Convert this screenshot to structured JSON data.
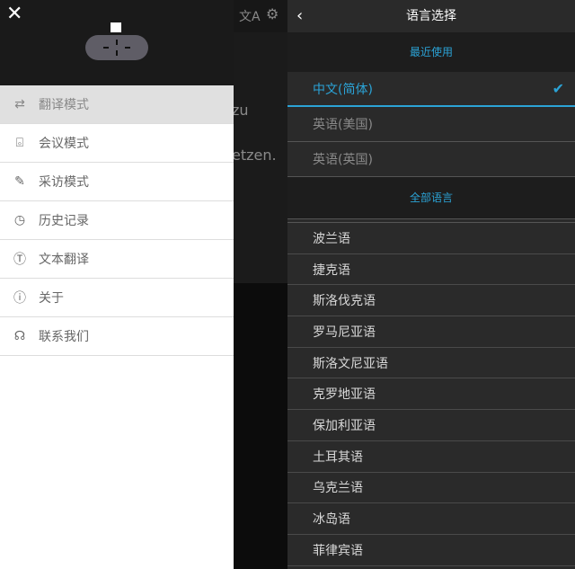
{
  "background": {
    "text_line1": "zu",
    "text_line2": "etzen.",
    "icons": [
      "translate-icon",
      "settings-icon"
    ]
  },
  "drawer": {
    "items": [
      {
        "label": "翻译模式",
        "icon": "swap-icon",
        "active": true
      },
      {
        "label": "会议模式",
        "icon": "meeting-device-icon"
      },
      {
        "label": "采访模式",
        "icon": "microphone-icon"
      },
      {
        "label": "历史记录",
        "icon": "history-icon"
      },
      {
        "label": "文本翻译",
        "icon": "text-icon"
      },
      {
        "label": "关于",
        "icon": "info-icon"
      },
      {
        "label": "联系我们",
        "icon": "headset-icon"
      }
    ]
  },
  "language_panel": {
    "title": "语言选择",
    "recent_header": "最近使用",
    "recent": [
      {
        "label": "中文(简体)",
        "selected": true
      },
      {
        "label": "英语(美国)"
      },
      {
        "label": "英语(英国)"
      }
    ],
    "all_header": "全部语言",
    "all": [
      "波兰语",
      "捷克语",
      "斯洛伐克语",
      "罗马尼亚语",
      "斯洛文尼亚语",
      "克罗地亚语",
      "保加利亚语",
      "土耳其语",
      "乌克兰语",
      "冰岛语",
      "菲律宾语"
    ]
  },
  "colors": {
    "accent": "#2ba3d6"
  }
}
